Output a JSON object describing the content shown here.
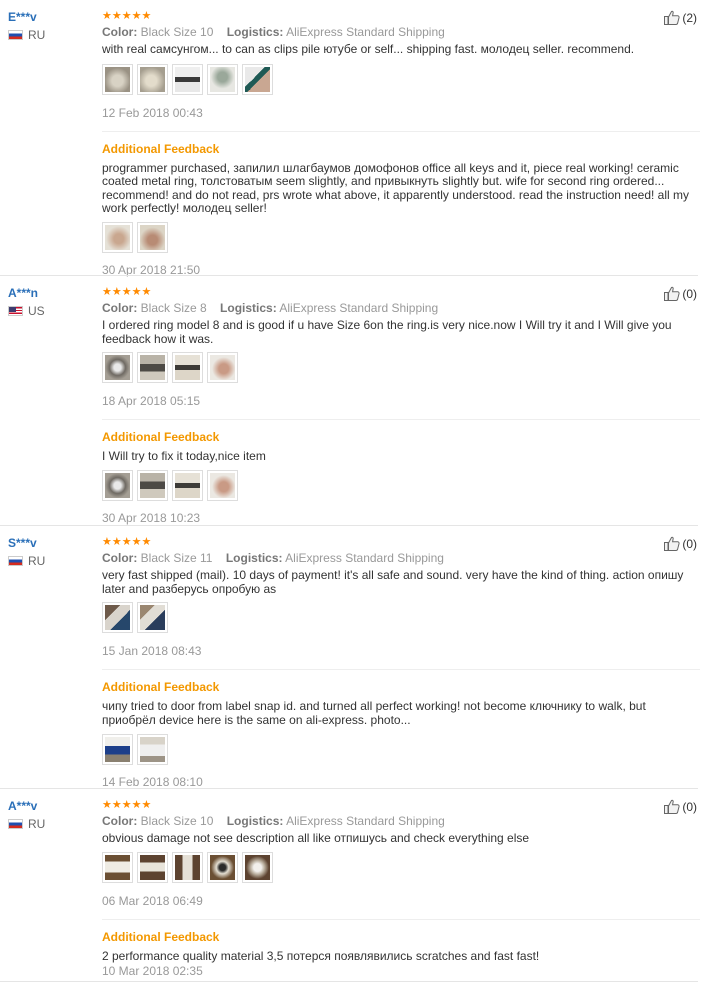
{
  "labels": {
    "color": "Color:",
    "logistics": "Logistics:",
    "additional_feedback": "Additional Feedback",
    "stars": "★★★★★"
  },
  "reviews": [
    {
      "user": "E***v",
      "country": "RU",
      "helpful": "(2)",
      "color_value": "Black Size 10",
      "logistics_value": "AliExpress Standard Shipping",
      "text": "with real самсунгом... to can as clips pile ютубе or self... shipping fast. молодец seller. recommend.",
      "date": "12 Feb 2018 00:43",
      "feedback_text": "programmer purchased, запилил шлагбаумов домофонов office all keys and it, piece real working! ceramic coated metal ring, толстоватым seem slightly, and привыкнуть slightly but. wife for second ring ordered... recommend! and do not read, prs wrote what above, it apparently understood. read the instruction need! all my work perfectly! молодец seller!",
      "feedback_date": "30 Apr 2018 21:50"
    },
    {
      "user": "A***n",
      "country": "US",
      "helpful": "(0)",
      "color_value": "Black Size 8",
      "logistics_value": "AliExpress Standard Shipping",
      "text": "I ordered ring model 8 and is good if u have Size 6on the ring.is very nice.now I Will try it and I Will give you feedback how it was.",
      "date": "18 Apr 2018 05:15",
      "feedback_text": "I Will try to fix it today,nice item",
      "feedback_date": "30 Apr 2018 10:23"
    },
    {
      "user": "S***v",
      "country": "RU",
      "helpful": "(0)",
      "color_value": "Black Size 11",
      "logistics_value": "AliExpress Standard Shipping",
      "text": "very fast shipped (mail). 10 days of payment! it's all safe and sound. very have the kind of thing. action опишу later and разберусь опробую as",
      "date": "15 Jan 2018 08:43",
      "feedback_text": "чипу tried to door from label snap id. and turned all perfect working! not become ключнику to walk, but приобрёл device here is the same on ali-express. photo...",
      "feedback_date": "14 Feb 2018 08:10"
    },
    {
      "user": "A***v",
      "country": "RU",
      "helpful": "(0)",
      "color_value": "Black Size 10",
      "logistics_value": "AliExpress Standard Shipping",
      "text": "obvious damage not see description all like отпишусь and check everything else",
      "date": "06 Mar 2018 06:49",
      "feedback_text": "2 performance quality material 3,5 потерся появлявились scratches and fast fast!",
      "feedback_date": "10 Mar 2018 02:35"
    }
  ],
  "colors": {
    "accent": "#f39800",
    "username": "#2a6fb8",
    "stars": "#ff8a00"
  }
}
